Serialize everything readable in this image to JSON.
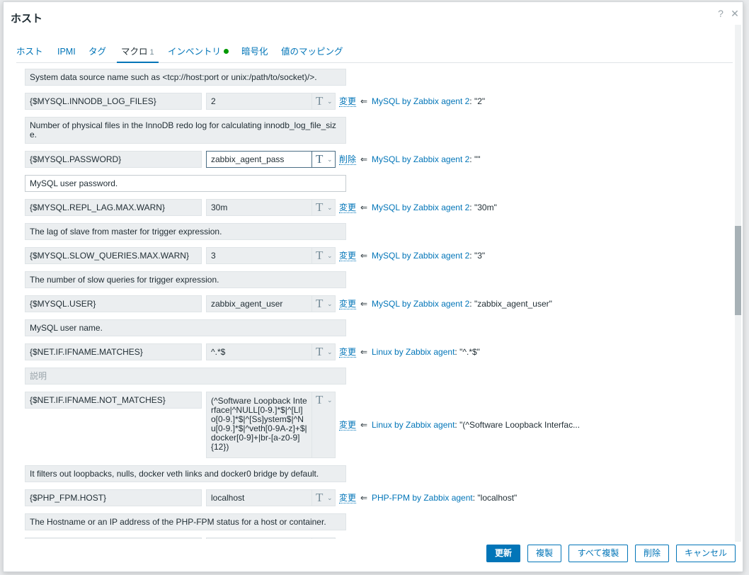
{
  "dialog": {
    "title": "ホスト",
    "help_icon": "?",
    "close_icon": "✕"
  },
  "tabs": [
    {
      "label": "ホスト"
    },
    {
      "label": "IPMI"
    },
    {
      "label": "タグ"
    },
    {
      "label": "マクロ",
      "count": "1"
    },
    {
      "label": "インベントリ"
    },
    {
      "label": "暗号化"
    },
    {
      "label": "値のマッピング"
    }
  ],
  "macros": {
    "top_description": "System data source name such as <tcp://host:port or unix:/path/to/socket)/>.",
    "rows": [
      {
        "name": "{$MYSQL.INNODB_LOG_FILES}",
        "value": "2",
        "action": "変更",
        "template": "MySQL by Zabbix agent 2",
        "inherited": ": \"2\"",
        "description": "Number of physical files in the InnoDB redo log for calculating innodb_log_file_size."
      },
      {
        "name": "{$MYSQL.PASSWORD}",
        "value": "zabbix_agent_pass",
        "action": "削除",
        "template": "MySQL by Zabbix agent 2",
        "inherited": ": \"\"",
        "description": "MySQL user password."
      },
      {
        "name": "{$MYSQL.REPL_LAG.MAX.WARN}",
        "value": "30m",
        "action": "変更",
        "template": "MySQL by Zabbix agent 2",
        "inherited": ": \"30m\"",
        "description": "The lag of slave from master for trigger expression."
      },
      {
        "name": "{$MYSQL.SLOW_QUERIES.MAX.WARN}",
        "value": "3",
        "action": "変更",
        "template": "MySQL by Zabbix agent 2",
        "inherited": ": \"3\"",
        "description": "The number of slow queries for trigger expression."
      },
      {
        "name": "{$MYSQL.USER}",
        "value": "zabbix_agent_user",
        "action": "変更",
        "template": "MySQL by Zabbix agent 2",
        "inherited": ": \"zabbix_agent_user\"",
        "description": "MySQL user name."
      },
      {
        "name": "{$NET.IF.IFNAME.MATCHES}",
        "value": "^.*$",
        "action": "変更",
        "template": "Linux by Zabbix agent",
        "inherited": ": \"^.*$\"",
        "description": "説明"
      },
      {
        "name": "{$NET.IF.IFNAME.NOT_MATCHES}",
        "value": "(^Software Loopback Interface|^NULL[0-9.]*$|^[Ll]o[0-9.]*$|^[Ss]ystem$|^Nu[0-9.]*$|^veth[0-9A-z]+$|docker[0-9]+|br-[a-z0-9]{12})",
        "action": "変更",
        "template": "Linux by Zabbix agent",
        "inherited": ": \"(^Software Loopback Interfac...",
        "description": "It filters out loopbacks, nulls, docker veth links and docker0 bridge by default."
      },
      {
        "name": "{$PHP_FPM.HOST}",
        "value": "localhost",
        "action": "変更",
        "template": "PHP-FPM by Zabbix agent",
        "inherited": ": \"localhost\"",
        "description": "The Hostname or an IP address of the PHP-FPM status for a host or container."
      }
    ],
    "type_glyph": "T",
    "chevron": "⌄",
    "arrow": "⇐"
  },
  "footer": {
    "update": "更新",
    "clone": "複製",
    "full_clone": "すべて複製",
    "delete": "削除",
    "cancel": "キャンセル"
  }
}
